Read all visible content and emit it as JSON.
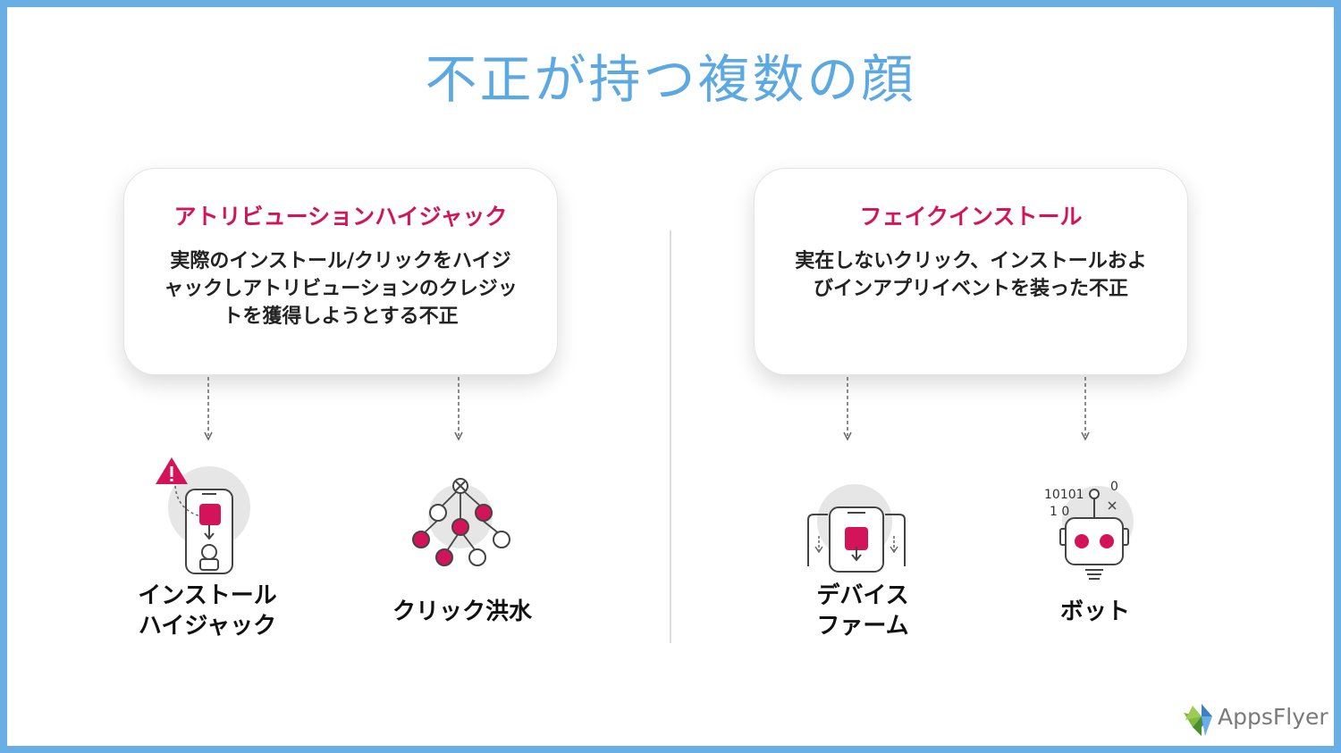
{
  "title": "不正が持つ複数の顔",
  "left_card": {
    "heading": "アトリビューションハイジャック",
    "description": "実際のインストール/クリックをハイジャックしアトリビューションのクレジットを獲得しようとする不正"
  },
  "right_card": {
    "heading": "フェイクインストール",
    "description": "実在しないクリック、インストールおよびインアプリイベントを装った不正"
  },
  "items": [
    {
      "label_line1": "インストール",
      "label_line2": "ハイジャック",
      "icon": "phone-warning-icon"
    },
    {
      "label_line1": "クリック洪水",
      "label_line2": "",
      "icon": "click-tree-icon"
    },
    {
      "label_line1": "デバイス",
      "label_line2": "ファーム",
      "icon": "device-farm-icon"
    },
    {
      "label_line1": "ボット",
      "label_line2": "",
      "icon": "robot-icon"
    }
  ],
  "bot_code": {
    "line1": "10101",
    "line2": "1 0",
    "extra": "0"
  },
  "logo": {
    "text": "AppsFlyer"
  },
  "colors": {
    "title": "#5ca8e0",
    "accent": "#d4145a",
    "frame": "#6aaee6"
  }
}
